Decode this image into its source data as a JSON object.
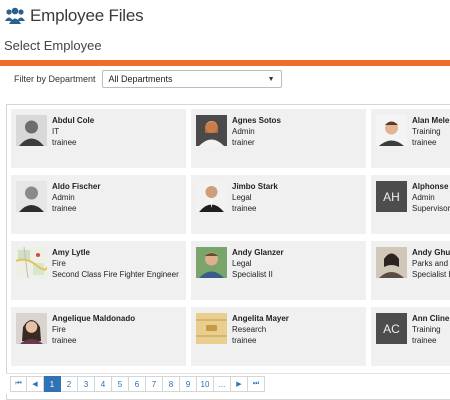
{
  "app": {
    "title": "Employee Files",
    "logo_icon": "people-group-icon"
  },
  "page": {
    "title": "Select Employee",
    "accent_color": "#ee6d2b"
  },
  "filter": {
    "label": "Filter by Department",
    "selected": "All Departments"
  },
  "employees": [
    {
      "name": "Abdul Cole",
      "department": "IT",
      "title": "trainee",
      "photo": "portrait-photo"
    },
    {
      "name": "Agnes Sotos",
      "department": "Admin",
      "title": "trainer",
      "photo": "portrait-photo"
    },
    {
      "name": "Alan Melen",
      "department": "Training",
      "title": "trainee",
      "photo": "portrait-photo"
    },
    {
      "name": "Aldo Fischer",
      "department": "Admin",
      "title": "trainee",
      "photo": "portrait-photo"
    },
    {
      "name": "Jimbo Stark",
      "department": "Legal",
      "title": "trainee",
      "photo": "portrait-photo"
    },
    {
      "name": "Alphonse H",
      "department": "Admin",
      "title": "Supervisor",
      "initials": "AH"
    },
    {
      "name": "Amy Lytle",
      "department": "Fire",
      "title": "Second Class Fire Fighter Engineer",
      "photo": "map-photo"
    },
    {
      "name": "Andy Glanzer",
      "department": "Legal",
      "title": "Specialist II",
      "photo": "portrait-photo"
    },
    {
      "name": "Andy Ghum",
      "department": "Parks and R",
      "title": "Specialist I",
      "photo": "portrait-photo"
    },
    {
      "name": "Angelique Maldonado",
      "department": "Fire",
      "title": "trainee",
      "photo": "portrait-photo"
    },
    {
      "name": "Angelita Mayer",
      "department": "Research",
      "title": "trainee",
      "photo": "folder-photo"
    },
    {
      "name": "Ann Cline",
      "department": "Training",
      "title": "trainee",
      "initials": "AC"
    }
  ],
  "pagination": {
    "first": "⏮",
    "prev": "◀",
    "pages": [
      "1",
      "2",
      "3",
      "4",
      "5",
      "6",
      "7",
      "8",
      "9",
      "10",
      "..."
    ],
    "next": "▶",
    "last": "⏭",
    "current": "1"
  }
}
